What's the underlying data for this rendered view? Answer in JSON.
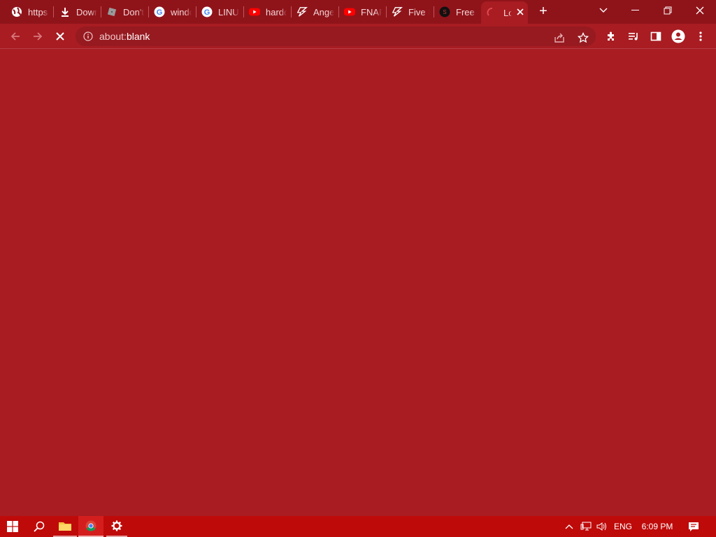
{
  "browser": {
    "tabs": [
      {
        "label": "https",
        "icon": "globe-icon"
      },
      {
        "label": "Down",
        "icon": "download-icon"
      },
      {
        "label": "Don't",
        "icon": "roblox-icon"
      },
      {
        "label": "windo",
        "icon": "google-icon"
      },
      {
        "label": "LINU",
        "icon": "google-icon"
      },
      {
        "label": "hardo",
        "icon": "youtube-icon"
      },
      {
        "label": "Ange",
        "icon": "lightning-icon"
      },
      {
        "label": "FNAF",
        "icon": "youtube-icon"
      },
      {
        "label": "Five N",
        "icon": "lightning-icon"
      },
      {
        "label": "Free",
        "icon": "site-icon"
      },
      {
        "label": "Lo",
        "icon": "loading-spinner-icon",
        "active": true
      }
    ],
    "new_tab_label": "+",
    "address": {
      "scheme": "about:",
      "host": "blank"
    }
  },
  "taskbar": {
    "language": "ENG",
    "time": "6:09 PM"
  },
  "colors": {
    "tabstrip": "#8f141a",
    "frame": "#a81c22",
    "omnibox": "#961a20",
    "taskbar": "#bf0a0a"
  }
}
